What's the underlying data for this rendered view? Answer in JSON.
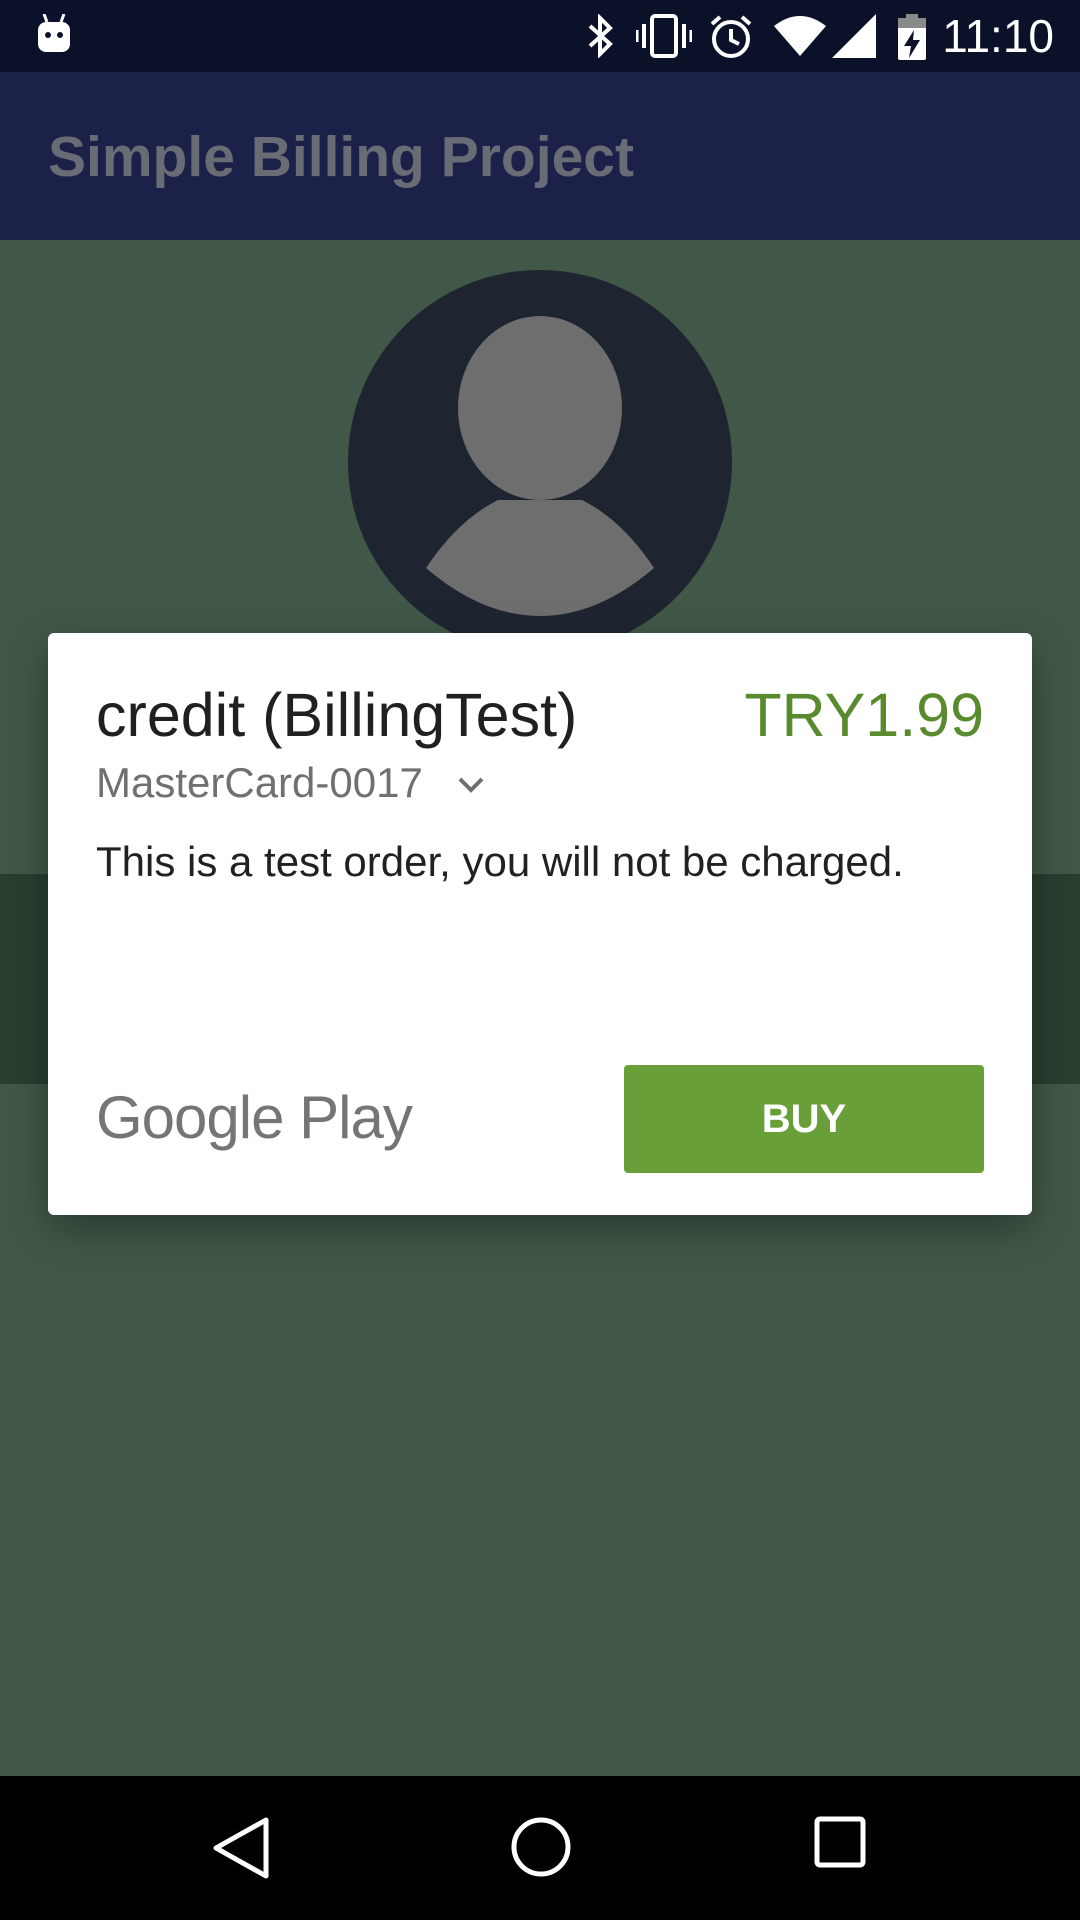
{
  "status_bar": {
    "time": "11:10",
    "icons": [
      "android-icon",
      "bluetooth-icon",
      "vibrate-icon",
      "alarm-icon",
      "wifi-icon",
      "cell-signal-icon",
      "battery-charging-icon"
    ]
  },
  "app_bar": {
    "title": "Simple Billing Project"
  },
  "dialog": {
    "title": "credit (BillingTest)",
    "price": "TRY1.99",
    "payment_method": "MasterCard-0017",
    "message": "This is a test order, you will not be charged.",
    "brand": "Google Play",
    "buy_label": "BUY"
  },
  "colors": {
    "price": "#5a8a2e",
    "buy_button": "#689f38",
    "app_bar": "#1b2149",
    "status_bar": "#0b1129",
    "content": "#415848"
  },
  "nav_bar": {
    "buttons": [
      "back-icon",
      "home-icon",
      "recents-icon"
    ]
  }
}
